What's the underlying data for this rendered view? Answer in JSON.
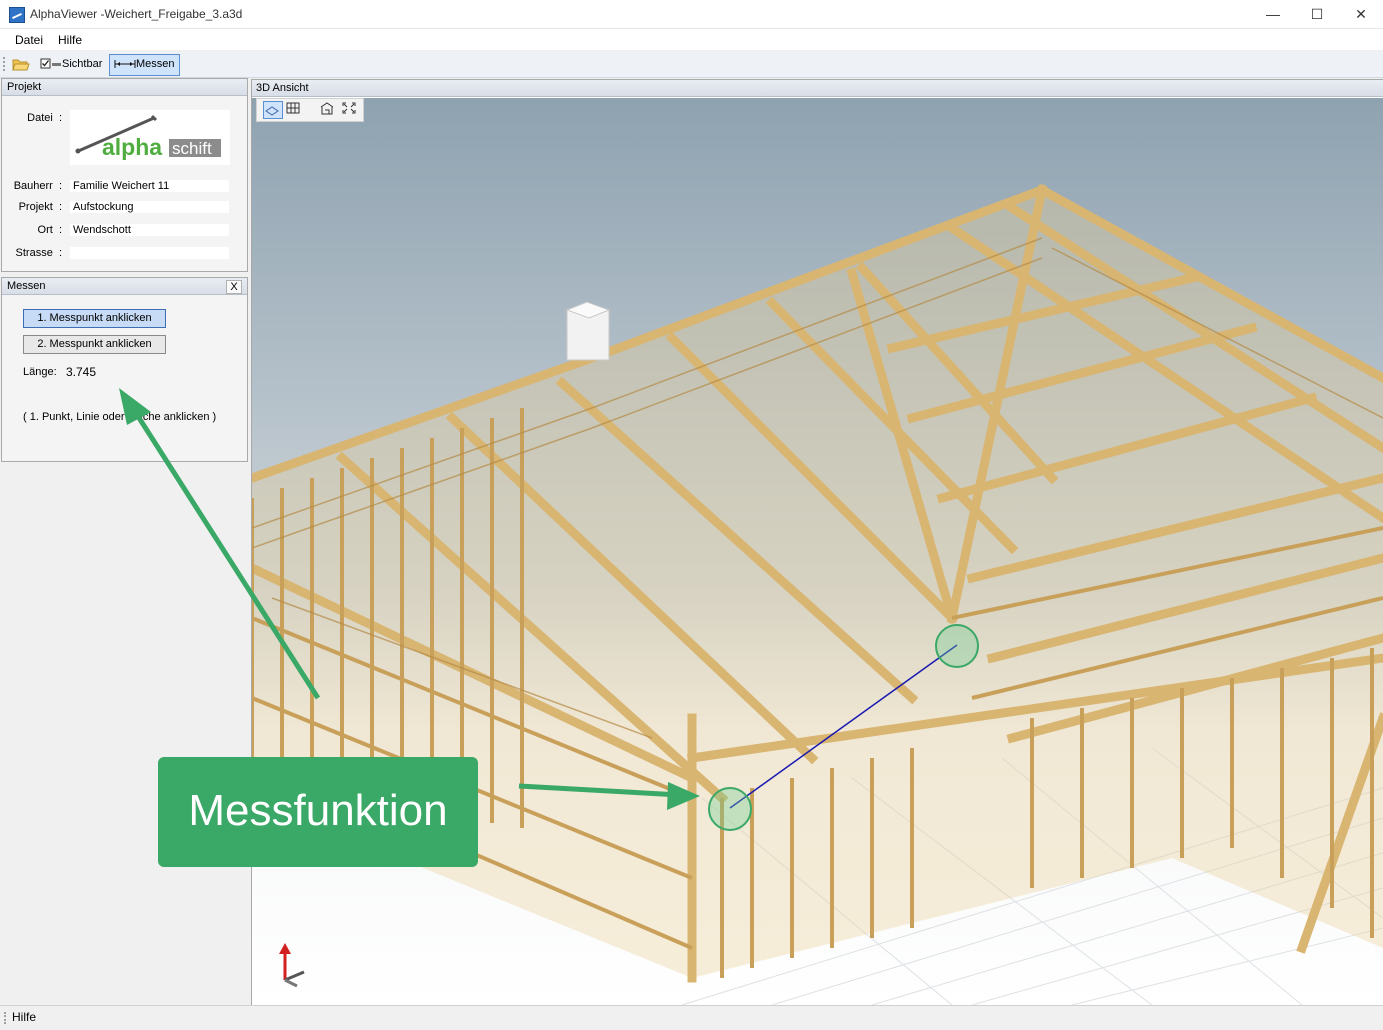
{
  "window": {
    "title": "AlphaViewer -Weichert_Freigabe_3.a3d",
    "minimize": "—",
    "maximize": "☐",
    "close": "✕"
  },
  "menu": {
    "items": [
      "Datei",
      "Hilfe"
    ]
  },
  "toolbar": {
    "sichtbar_label": "Sichtbar",
    "messen_label": "Messen"
  },
  "project_panel": {
    "header": "Projekt",
    "logo_text": {
      "alpha": "alpha",
      "schift": "schift"
    },
    "fields": [
      {
        "label": "Datei",
        "value": ""
      },
      {
        "label": "Bauherr",
        "value": "Familie Weichert  11"
      },
      {
        "label": "Projekt",
        "value": "Aufstockung"
      },
      {
        "label": "Ort",
        "value": "Wendschott"
      },
      {
        "label": "Strasse",
        "value": ""
      }
    ]
  },
  "measure_panel": {
    "header": "Messen",
    "close_label": "X",
    "point1_label": "1. Messpunkt anklicken",
    "point2_label": "2. Messpunkt anklicken",
    "length_label": "Länge:",
    "length_value": "3.745",
    "hint": "( 1.  Punkt, Linie oder Fläche anklicken )"
  },
  "view": {
    "header": "3D Ansicht"
  },
  "callout": {
    "text": "Messfunktion"
  },
  "statusbar": {
    "text": "Hilfe"
  },
  "colors": {
    "accent": "#3aa866",
    "wood": "#e2c182",
    "sky_top": "#8fa3b1",
    "selection": "#cfe3fb"
  }
}
